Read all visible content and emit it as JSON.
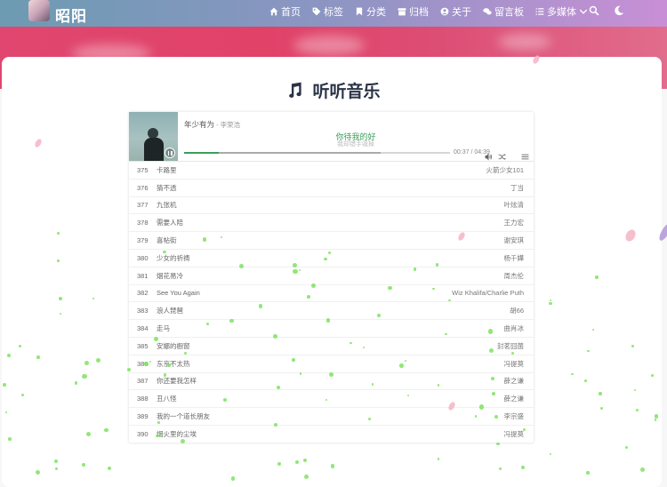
{
  "nav": {
    "site_name": "昭阳",
    "menu": [
      {
        "label": "首页",
        "icon": "home-icon"
      },
      {
        "label": "标签",
        "icon": "tag-icon"
      },
      {
        "label": "分类",
        "icon": "bookmark-icon"
      },
      {
        "label": "归档",
        "icon": "archive-icon"
      },
      {
        "label": "关于",
        "icon": "user-circle-icon"
      },
      {
        "label": "留言板",
        "icon": "comments-icon"
      },
      {
        "label": "多媒体",
        "icon": "list-icon"
      }
    ]
  },
  "page": {
    "title": "听听音乐"
  },
  "player": {
    "song_title": "年少有为",
    "song_artist": " - 李荣浩",
    "lyric_current": "你待我的好",
    "lyric_next": "我却错手毁掉",
    "time_current": "00:37",
    "time_total": "04:39",
    "progress_fraction": 0.13,
    "loaded_fraction": 0.74
  },
  "playlist": [
    {
      "index": "375",
      "title": "卡路里",
      "artist": "火箭少女101"
    },
    {
      "index": "376",
      "title": "猜不透",
      "artist": "丁当"
    },
    {
      "index": "377",
      "title": "九张机",
      "artist": "叶炫清"
    },
    {
      "index": "378",
      "title": "需要人陪",
      "artist": "王力宏"
    },
    {
      "index": "379",
      "title": "喜帖街",
      "artist": "谢安琪"
    },
    {
      "index": "380",
      "title": "少女的祈祷",
      "artist": "杨千嬅"
    },
    {
      "index": "381",
      "title": "烟花易冷",
      "artist": "周杰伦"
    },
    {
      "index": "382",
      "title": "See You Again",
      "artist": "Wiz Khalifa/Charlie Puth"
    },
    {
      "index": "383",
      "title": "浪人琵琶",
      "artist": "胡66"
    },
    {
      "index": "384",
      "title": "走马",
      "artist": "曲肖冰"
    },
    {
      "index": "385",
      "title": "安娜的橱窗",
      "artist": "封茗囧菌"
    },
    {
      "index": "386",
      "title": "东京不太热",
      "artist": "冯提莫"
    },
    {
      "index": "387",
      "title": "你还要我怎样",
      "artist": "薛之谦"
    },
    {
      "index": "388",
      "title": "丑八怪",
      "artist": "薛之谦"
    },
    {
      "index": "389",
      "title": "我的一个道长朋友",
      "artist": "李宗盛"
    },
    {
      "index": "390",
      "title": "烟火里的尘埃",
      "artist": "冯提莫"
    }
  ]
}
